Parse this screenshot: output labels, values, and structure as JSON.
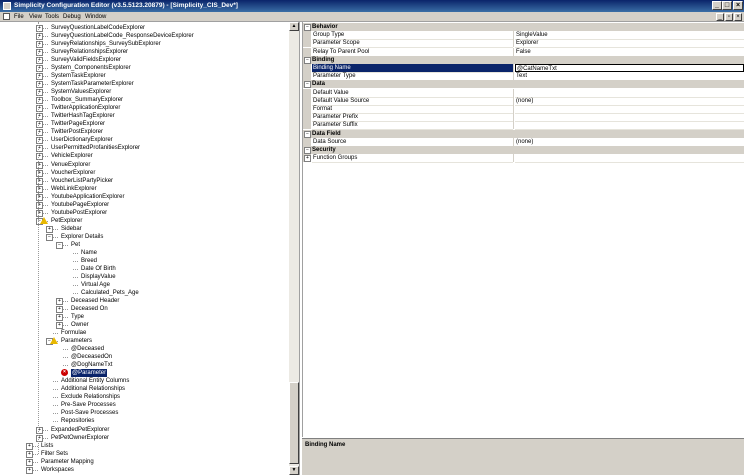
{
  "window": {
    "title": "Simplicity Configuration Editor (v3.5.5123.20879) - [Simplicity_CIS_Dev*]",
    "minimize": "_",
    "maximize": "□",
    "close": "×"
  },
  "menu": {
    "items": [
      "File",
      "View",
      "Tools",
      "Debug",
      "Window"
    ],
    "mdi_minimize": "_",
    "mdi_restore": "▫",
    "mdi_close": "×"
  },
  "tree": {
    "expander_plus": "+",
    "expander_minus": "−",
    "error_glyph": "×",
    "rows": [
      {
        "label": "SurveyQuestionLabelCodeExplorer",
        "exp": "+"
      },
      {
        "label": "SurveyQuestionLabelCode_ResponseDeviceExplorer",
        "exp": "+"
      },
      {
        "label": "SurveyRelationships_SurveySubExplorer",
        "exp": "+"
      },
      {
        "label": "SurveyRelationshipsExplorer",
        "exp": "+"
      },
      {
        "label": "SurveyValidFieldsExplorer",
        "exp": "+"
      },
      {
        "label": "System_ComponentsExplorer",
        "exp": "+"
      },
      {
        "label": "SystemTaskExplorer",
        "exp": "+"
      },
      {
        "label": "SystemTaskParameterExplorer",
        "exp": "+"
      },
      {
        "label": "SystemValuesExplorer",
        "exp": "+"
      },
      {
        "label": "Toolbox_SummaryExplorer",
        "exp": "+"
      },
      {
        "label": "TwitterApplicationExplorer",
        "exp": "+"
      },
      {
        "label": "TwitterHashTagExplorer",
        "exp": "+"
      },
      {
        "label": "TwitterPageExplorer",
        "exp": "+"
      },
      {
        "label": "TwitterPostExplorer",
        "exp": "+"
      },
      {
        "label": "UserDictionaryExplorer",
        "exp": "+"
      },
      {
        "label": "UserPermittedProfanitiesExplorer",
        "exp": "+"
      },
      {
        "label": "VehicleExplorer",
        "exp": "+"
      },
      {
        "label": "VenueExplorer",
        "exp": "+"
      },
      {
        "label": "VoucherExplorer",
        "exp": "+"
      },
      {
        "label": "VoucherListPartyPicker",
        "exp": "+"
      },
      {
        "label": "WebLinkExplorer",
        "exp": "+"
      },
      {
        "label": "YoutubeApplicationExplorer",
        "exp": "+"
      },
      {
        "label": "YoutubePageExplorer",
        "exp": "+"
      },
      {
        "label": "YoutubePostExplorer",
        "exp": "+"
      },
      {
        "label": "PetExplorer",
        "exp": "-",
        "warn": true
      },
      {
        "label": "Sidebar",
        "exp": "+",
        "level": 1
      },
      {
        "label": "Explorer Details",
        "exp": "-",
        "level": 1
      },
      {
        "label": "Pet",
        "exp": "-",
        "level": 2
      },
      {
        "label": "Name",
        "level": 3
      },
      {
        "label": "Breed",
        "level": 3
      },
      {
        "label": "Date Of Birth",
        "level": 3
      },
      {
        "label": "DisplayValue",
        "level": 3
      },
      {
        "label": "Virtual Age",
        "level": 3
      },
      {
        "label": "Calculated_Pets_Age",
        "level": 3
      },
      {
        "label": "Deceased Header",
        "exp": "+",
        "level": 2
      },
      {
        "label": "Deceased On",
        "exp": "+",
        "level": 2
      },
      {
        "label": "Type",
        "exp": "+",
        "level": 2
      },
      {
        "label": "Owner",
        "exp": "+",
        "level": 2
      },
      {
        "label": "Formulae",
        "level": 1
      },
      {
        "label": "Parameters",
        "exp": "-",
        "level": 1,
        "warn": true
      },
      {
        "label": "@Deceased",
        "level": 2
      },
      {
        "label": "@DeceasedOn",
        "level": 2
      },
      {
        "label": "@DogNameTxt",
        "level": 2
      },
      {
        "label": "@Parameter",
        "level": 2,
        "error": true,
        "selected": true
      },
      {
        "label": "Additional Entity Columns",
        "level": 1
      },
      {
        "label": "Additional Relationships",
        "level": 1
      },
      {
        "label": "Exclude Relationships",
        "level": 1
      },
      {
        "label": "Pre-Save Processes",
        "level": 1
      },
      {
        "label": "Post-Save Processes",
        "level": 1
      },
      {
        "label": "Repositories",
        "level": 1
      },
      {
        "label": "ExpandedPetExplorer",
        "exp": "+"
      },
      {
        "label": "PetPetOwnerExplorer",
        "exp": "+"
      },
      {
        "label": "Lists",
        "exp": "+",
        "level": -1
      },
      {
        "label": "Filter Sets",
        "exp": "+",
        "level": -1
      },
      {
        "label": "Parameter Mapping",
        "exp": "+",
        "level": -1
      },
      {
        "label": "Workspaces",
        "exp": "+",
        "level": -1
      }
    ]
  },
  "scroll": {
    "up": "▲",
    "down": "▼"
  },
  "properties": {
    "rows": [
      {
        "type": "cat",
        "label": "Behavior"
      },
      {
        "name": "Group Type",
        "value": "SingleValue"
      },
      {
        "name": "Parameter Scope",
        "value": "Explorer"
      },
      {
        "name": "Relay To Parent Pool",
        "value": "False"
      },
      {
        "type": "cat",
        "label": "Binding"
      },
      {
        "name": "Binding Name",
        "value": "@CatNameTxt",
        "selected": true
      },
      {
        "name": "Parameter Type",
        "value": "Text"
      },
      {
        "type": "cat",
        "label": "Data"
      },
      {
        "name": "Default Value",
        "value": ""
      },
      {
        "name": "Default Value Source",
        "value": "(none)"
      },
      {
        "name": "Format",
        "value": ""
      },
      {
        "name": "Parameter Prefix",
        "value": ""
      },
      {
        "name": "Parameter Suffix",
        "value": ""
      },
      {
        "type": "cat",
        "label": "Data Field"
      },
      {
        "name": "Data Source",
        "value": "(none)"
      },
      {
        "type": "cat",
        "label": "Security"
      },
      {
        "name": "Function Groups",
        "value": "",
        "expandable": true
      }
    ]
  },
  "description": {
    "title": "Binding Name"
  }
}
